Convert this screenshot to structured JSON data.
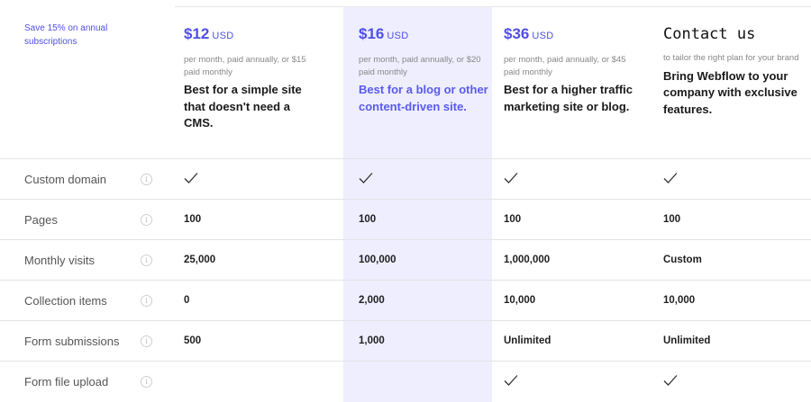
{
  "promo": "Save 15% on annual subscriptions",
  "plans": [
    {
      "price": "$12",
      "currency": "USD",
      "terms": "per month, paid annually, or $15 paid monthly",
      "description": "Best for a simple site that doesn't need a CMS."
    },
    {
      "price": "$16",
      "currency": "USD",
      "terms": "per month, paid annually, or $20 paid monthly",
      "description": "Best for a blog or other content-driven site.",
      "featured": true
    },
    {
      "price": "$36",
      "currency": "USD",
      "terms": "per month, paid annually, or $45 paid monthly",
      "description": "Best for a higher traffic marketing site or blog."
    },
    {
      "title": "Contact us",
      "terms": "to tailor the right plan for your brand",
      "description": "Bring Webflow to your company with exclusive features."
    }
  ],
  "features": [
    {
      "label": "Custom domain",
      "values": [
        "check",
        "check",
        "check",
        "check"
      ]
    },
    {
      "label": "Pages",
      "values": [
        "100",
        "100",
        "100",
        "100"
      ]
    },
    {
      "label": "Monthly visits",
      "values": [
        "25,000",
        "100,000",
        "1,000,000",
        "Custom"
      ]
    },
    {
      "label": "Collection items",
      "values": [
        "0",
        "2,000",
        "10,000",
        "10,000"
      ]
    },
    {
      "label": "Form submissions",
      "values": [
        "500",
        "1,000",
        "Unlimited",
        "Unlimited"
      ]
    },
    {
      "label": "Form file upload",
      "values": [
        "",
        "",
        "check",
        "check"
      ]
    }
  ],
  "info_icon_glyph": "i",
  "colors": {
    "accent": "#4f4fe8",
    "highlight_column": "#eeeeff",
    "featured_text": "#5a5af0"
  }
}
